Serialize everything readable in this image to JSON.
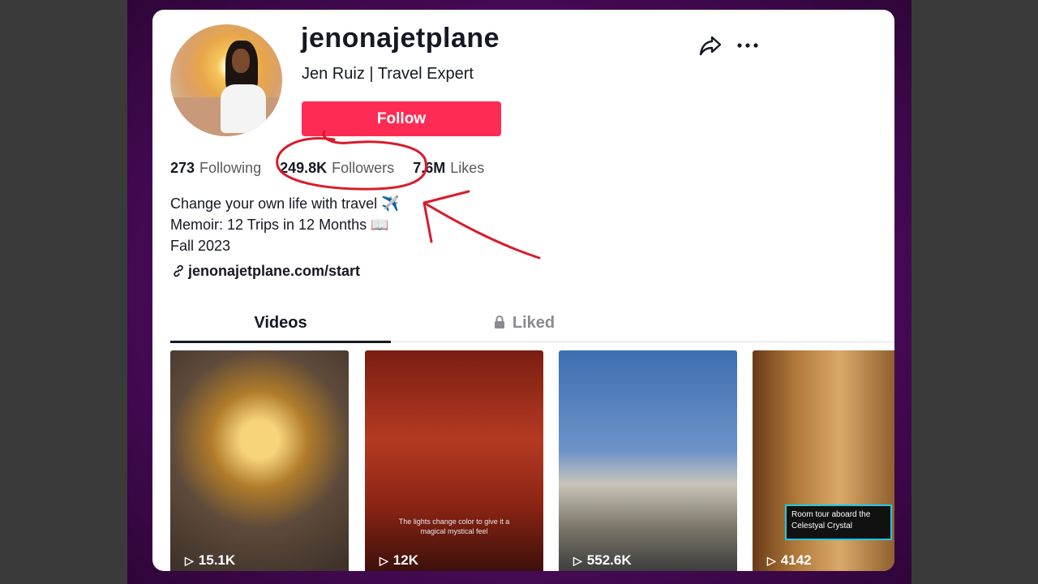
{
  "profile": {
    "username": "jenonajetplane",
    "subtitle": "Jen Ruiz | Travel Expert",
    "follow_label": "Follow",
    "stats": {
      "following_count": "273",
      "following_label": "Following",
      "followers_count": "249.8K",
      "followers_label": "Followers",
      "likes_count": "7.6M",
      "likes_label": "Likes"
    },
    "bio": [
      "Change your own life with travel ✈️",
      "Memoir: 12 Trips in 12 Months 📖",
      "Fall 2023"
    ],
    "link": "jenonajetplane.com/start"
  },
  "tabs": {
    "videos": "Videos",
    "liked": "Liked"
  },
  "videos": [
    {
      "views": "15.1K"
    },
    {
      "views": "12K",
      "caption": "The lights change color to give it a magical mystical feel"
    },
    {
      "views": "552.6K"
    },
    {
      "views": "4142",
      "caption_box": "Room tour aboard the Celestyal Crystal"
    }
  ],
  "colors": {
    "follow_button": "#fe2c55",
    "annotation": "#d81c2a",
    "frame": "#5a0c6e"
  },
  "icons": [
    "share-icon",
    "more-icon",
    "link-icon",
    "lock-icon",
    "play-icon"
  ]
}
